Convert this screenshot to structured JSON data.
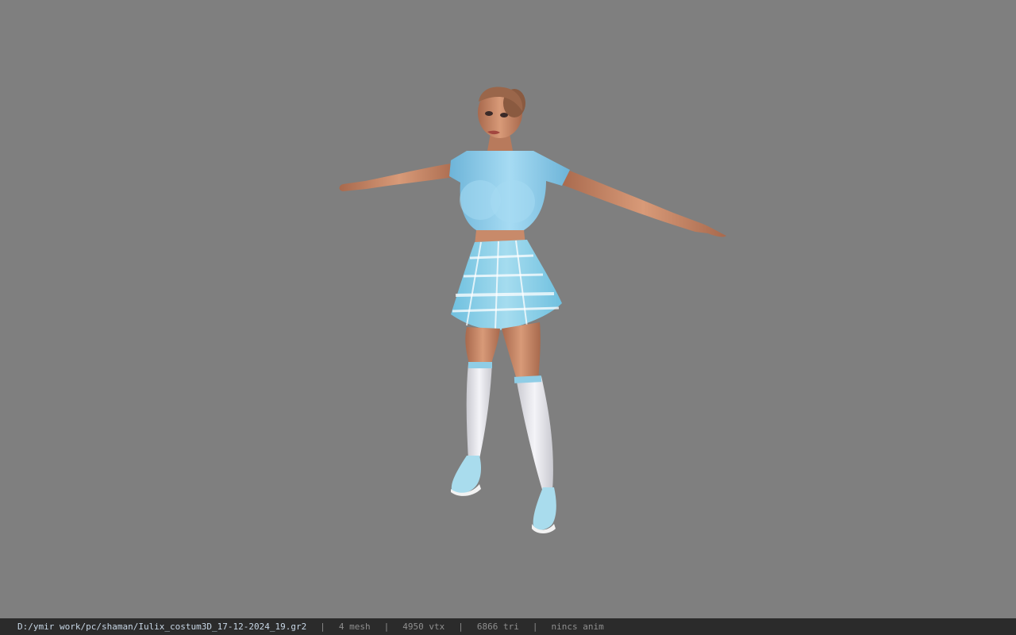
{
  "viewer": {
    "background_color": "#7f7f7f",
    "model_colors": {
      "skin": "#c98a6a",
      "top": "#8fcdea",
      "skirt": "#9fd6ea",
      "skirt_stripes": "#ffffff",
      "socks": "#e9e9ee",
      "shoes": "#a9dced",
      "hair": "#3a2a22"
    }
  },
  "statusbar": {
    "file_path": "D:/ymir work/pc/shaman/Iulix_costum3D_17-12-2024_19.gr2",
    "separator": "|",
    "mesh_count": "4 mesh",
    "vertex_count": "4950 vtx",
    "triangle_count": "6866 tri",
    "anim_status": "nincs anim"
  }
}
